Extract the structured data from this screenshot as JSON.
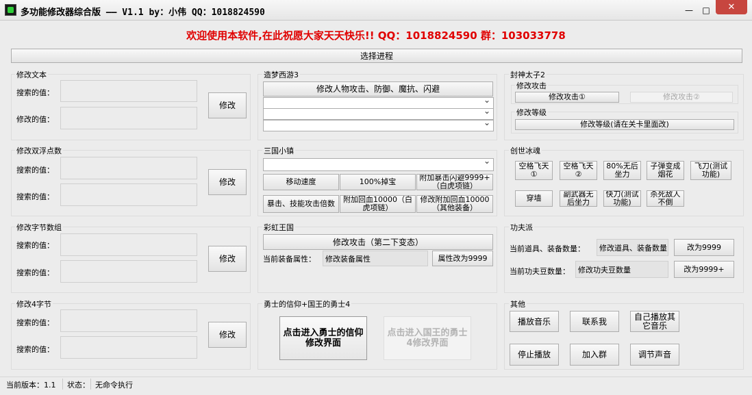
{
  "window": {
    "title": "多功能修改器综合版  ——  V1.1 by：小伟 QQ：1018824590",
    "min": "—",
    "max": "□",
    "close": "✕"
  },
  "welcome": "欢迎使用本软件,在此祝愿大家天天快乐!! QQ：1018824590  群：103033778",
  "select_process": "选择进程",
  "text_mod": {
    "title": "修改文本",
    "search_label": "搜索的值：",
    "modify_label": "修改的值：",
    "modify_button": "修改"
  },
  "double_mod": {
    "title": "修改双浮点数",
    "search_label_1": "搜索的值：",
    "search_label_2": "搜索的值：",
    "modify_button": "修改"
  },
  "bytes_mod": {
    "title": "修改字节数组",
    "search_label_1": "搜索的值：",
    "search_label_2": "搜索的值：",
    "modify_button": "修改"
  },
  "int4_mod": {
    "title": "修改4字节",
    "search_label_1": "搜索的值：",
    "search_label_2": "搜索的值：",
    "modify_button": "修改"
  },
  "zaomeng": {
    "title": "造梦西游3",
    "button": "修改人物攻击、防御、魔抗、闪避"
  },
  "sanguo": {
    "title": "三国小镇",
    "btn_speed": "移动速度",
    "btn_drop": "100%掉宝",
    "btn_crit": "附加暴击闪避9999+（白虎项链）",
    "btn_atk": "暴击、技能攻击倍数",
    "btn_hp": "附加回血10000（白虎项链）",
    "btn_hp2": "修改附加回血10000（其他装备）"
  },
  "caihong": {
    "title": "彩虹王国",
    "btn_attack": "修改攻击（第二下变态）",
    "equip_label": "当前装备属性：",
    "equip_value": "修改装备属性",
    "btn_attr": "属性改为9999"
  },
  "yongshi": {
    "title": "勇士的信仰+国王的勇士4",
    "btn_faith": "点击进入勇士的信仰修改界面",
    "btn_king": "点击进入国王的勇士4修改界面"
  },
  "fengshen": {
    "title": "封神太子2",
    "atk_group": "修改攻击",
    "btn_atk1": "修改攻击①",
    "btn_atk2": "修改攻击②",
    "lvl_group": "修改等级",
    "btn_lvl": "修改等级(请在关卡里面改)"
  },
  "chuangshi": {
    "title": "创世冰魂",
    "b1": "空格飞天①",
    "b2": "空格飞天②",
    "b3": "80%无后坐力",
    "b4": "子弹变成烟花",
    "b5": "飞刀(测试功能)",
    "b6": "穿墙",
    "b7": "副武器无后坐力",
    "b8": "快刀(测试功能)",
    "b9": "杀死敌人不倒"
  },
  "gongfu": {
    "title": "功夫派",
    "item_label": "当前道具、装备数量：",
    "item_value": "修改道具、装备数量",
    "btn_item": "改为9999",
    "bean_label": "当前功夫豆数量：",
    "bean_value": "修改功夫豆数量",
    "btn_bean": "改为9999+"
  },
  "other": {
    "title": "其他",
    "play": "播放音乐",
    "contact": "联系我",
    "self_play": "自己播放其它音乐",
    "stop": "停止播放",
    "join": "加入群",
    "volume": "调节声音"
  },
  "status": {
    "version_label": "当前版本：1.1",
    "state_label": "状态：",
    "state_value": "无命令执行"
  }
}
